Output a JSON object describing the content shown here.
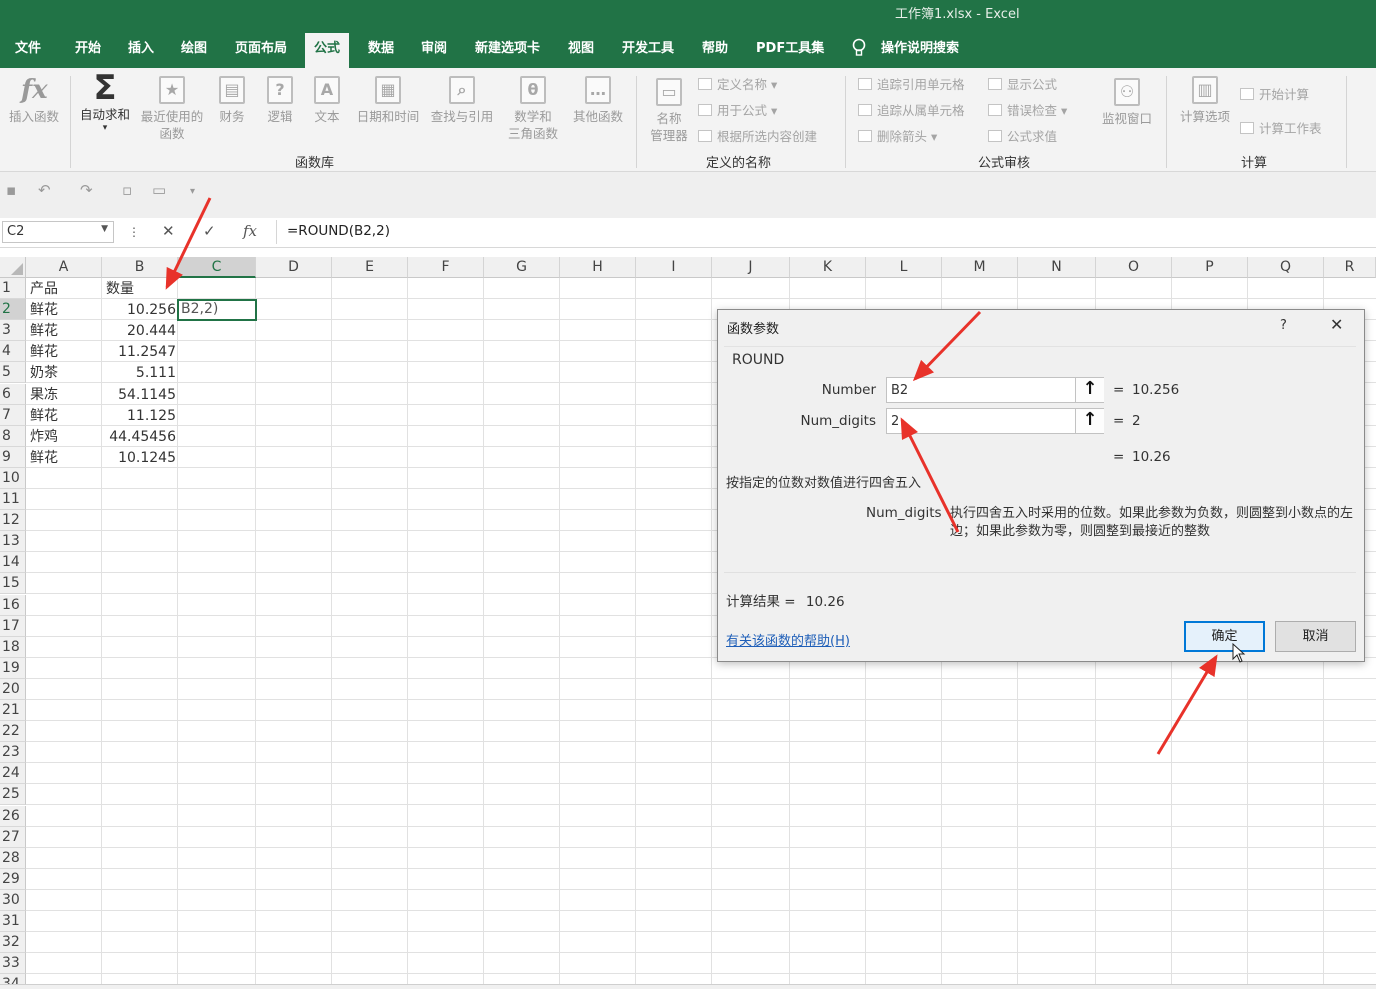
{
  "window": {
    "title": "工作簿1.xlsx  -  Excel"
  },
  "tabs": [
    "文件",
    "开始",
    "插入",
    "绘图",
    "页面布局",
    "公式",
    "数据",
    "审阅",
    "新建选项卡",
    "视图",
    "开发工具",
    "帮助",
    "PDF工具集"
  ],
  "active_tab": "公式",
  "tell_me": "操作说明搜索",
  "ribbon": {
    "function_library": {
      "group_label": "函数库",
      "buttons": [
        {
          "label": "插入函数",
          "icon": "fx-icon"
        },
        {
          "label": "自动求和",
          "icon": "sigma-icon"
        },
        {
          "label": "最近使用的",
          "label2": "函数",
          "icon": "star-icon"
        },
        {
          "label": "财务",
          "icon": "finance-icon"
        },
        {
          "label": "逻辑",
          "icon": "question-icon"
        },
        {
          "label": "文本",
          "icon": "text-icon"
        },
        {
          "label": "日期和时间",
          "icon": "calendar-icon"
        },
        {
          "label": "查找与引用",
          "icon": "lookup-icon"
        },
        {
          "label": "数学和",
          "label2": "三角函数",
          "icon": "math-icon"
        },
        {
          "label": "其他函数",
          "icon": "more-icon"
        }
      ]
    },
    "defined_names": {
      "group_label": "定义的名称",
      "manager": "名称\n管理器",
      "manager_l1": "名称",
      "manager_l2": "管理器",
      "items": [
        "定义名称",
        "用于公式",
        "根据所选内容创建"
      ]
    },
    "formula_auditing": {
      "group_label": "公式审核",
      "items": [
        "追踪引用单元格",
        "追踪从属单元格",
        "删除箭头",
        "显示公式",
        "错误检查",
        "公式求值"
      ],
      "watch": "监视窗口"
    },
    "calculation": {
      "group_label": "计算",
      "options": "计算选项",
      "items": [
        "开始计算",
        "计算工作表"
      ]
    }
  },
  "formula_bar": {
    "name_box": "C2",
    "formula": "=ROUND(B2,2)"
  },
  "columns": [
    "A",
    "B",
    "C",
    "D",
    "E",
    "F",
    "G",
    "H",
    "I",
    "J",
    "K",
    "L",
    "M",
    "N",
    "O",
    "P",
    "Q",
    "R"
  ],
  "rows": [
    "1",
    "2",
    "3",
    "4",
    "5",
    "6",
    "7",
    "8",
    "9",
    "10",
    "11",
    "12",
    "13",
    "14",
    "15",
    "16",
    "17",
    "18",
    "19",
    "20",
    "21",
    "22",
    "23",
    "24",
    "25",
    "26",
    "27",
    "28",
    "29",
    "30",
    "31",
    "32",
    "33",
    "34"
  ],
  "sheet": {
    "header": {
      "a": "产品",
      "b": "数量"
    },
    "data": [
      {
        "a": "鲜花",
        "b": "10.256"
      },
      {
        "a": "鲜花",
        "b": "20.444"
      },
      {
        "a": "鲜花",
        "b": "11.2547"
      },
      {
        "a": "奶茶",
        "b": "5.111"
      },
      {
        "a": "果冻",
        "b": "54.1145"
      },
      {
        "a": "鲜花",
        "b": "11.125"
      },
      {
        "a": "炸鸡",
        "b": "44.45456"
      },
      {
        "a": "鲜花",
        "b": "10.1245"
      }
    ],
    "active_cell_text": "B2,2)"
  },
  "dialog": {
    "title": "函数参数",
    "help_glyph": "?",
    "close_glyph": "✕",
    "function_name": "ROUND",
    "args": [
      {
        "label": "Number",
        "value": "B2",
        "result": "10.256"
      },
      {
        "label": "Num_digits",
        "value": "2",
        "result": "2"
      }
    ],
    "eq": "=",
    "overall_result": "10.26",
    "description": "按指定的位数对数值进行四舍五入",
    "arg_help_name": "Num_digits",
    "arg_help_text": "执行四舍五入时采用的位数。如果此参数为负数，则圆整到小数点的左边；如果此参数为零，则圆整到最接近的整数",
    "result_label": "计算结果 =",
    "result_value": "10.26",
    "help_link": "有关该函数的帮助(H)",
    "ok": "确定",
    "cancel": "取消"
  },
  "colors": {
    "excel_green": "#217346",
    "annotation_red": "#e8322a",
    "accent_blue": "#0078d7"
  }
}
